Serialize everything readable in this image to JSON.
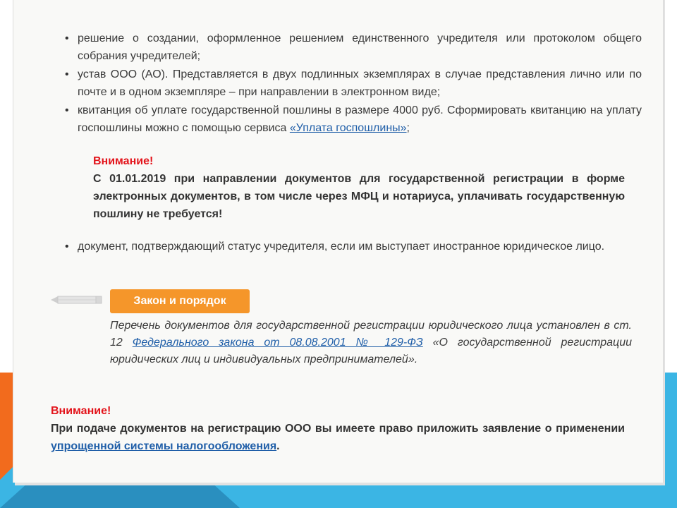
{
  "documents_list": [
    {
      "text": "решение о создании, оформленное решением единственного учредителя или протоколом общего собрания учредителей;"
    },
    {
      "text": "устав ООО (АО). Представляется в двух подлинных экземплярах в случае представления лично или по почте и в одном экземпляре – при направлении в электронном виде;"
    },
    {
      "text_before": "квитанция об уплате государственной пошлины в размере 4000 руб. Сформировать квитанцию на уплату госпошлины можно с помощью сервиса ",
      "link": "«Уплата госпошлины»",
      "text_after": ";"
    }
  ],
  "attention_1": {
    "title": "Внимание!",
    "body": "С 01.01.2019 при направлении документов для государственной регистрации в форме электронных документов, в том числе через МФЦ и нотариуса, уплачивать государственную пошлину не требуется!"
  },
  "foreign_item": {
    "text": "документ, подтверждающий статус учредителя, если им выступает иностранное юридическое лицо."
  },
  "law_section": {
    "badge": "Закон и порядок",
    "text_before": "Перечень документов для государственной регистрации юридического лица установлен в ст. 12 ",
    "link": "Федерального закона от 08.08.2001 № 129-ФЗ",
    "text_after": " «О государственной регистрации юридических лиц и индивидуальных предпринимателей»."
  },
  "attention_2": {
    "title": "Внимание!",
    "body_before": "При подаче документов на регистрацию ООО вы имеете право приложить заявление о применении ",
    "link": "упрощенной системы налогообложения",
    "body_after": "."
  },
  "colors": {
    "attention_red": "#e3141b",
    "badge_orange": "#f5962a",
    "link_blue": "#1f5ea8",
    "slide_orange": "#f26b1d",
    "slide_cyan": "#3bb5e4"
  },
  "icons": {
    "bullet": "•",
    "pencil": "pencil-icon"
  }
}
